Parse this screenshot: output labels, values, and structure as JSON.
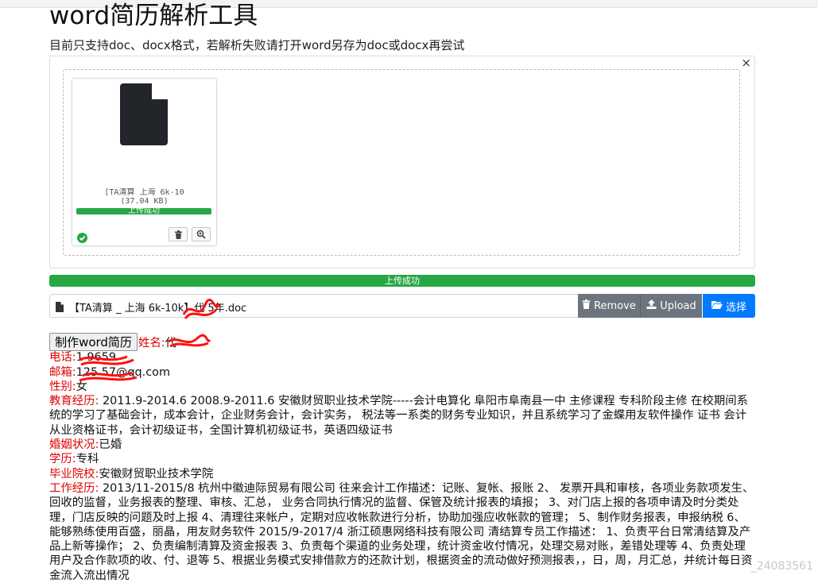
{
  "page": {
    "title": "word简历解析工具",
    "subtitle": "目前只支持doc、docx格式，若解析失败请打开word另存为doc或docx再尝试"
  },
  "dropzone": {
    "close_label": "×",
    "thumb": {
      "caption_line1": "[TA清算 上海 6k-10",
      "caption_line2": "(37.04 KB)",
      "status": "上传成功",
      "icons": [
        "file-icon",
        "check-circle-icon",
        "trash-icon",
        "zoom-icon"
      ]
    }
  },
  "progress": {
    "label": "上传成功",
    "percent": 100,
    "color": "#28a745"
  },
  "file_input": {
    "file_name": "【TA清算 _ 上海 6k-10k】代 5年.doc",
    "remove_label": "Remove",
    "upload_label": "Upload",
    "browse_label": "选择"
  },
  "make_button": {
    "label": "制作word简历"
  },
  "resume": {
    "name": {
      "key": "姓名:",
      "value": "代"
    },
    "phone": {
      "key": "电话:",
      "value": "1     9659"
    },
    "email": {
      "key": "邮箱:",
      "value": "125     57@qq.com"
    },
    "gender": {
      "key": "性别:",
      "value": "女"
    },
    "education": {
      "key": "教育经历:",
      "value": " 2011.9-2014.6 2008.9-2011.6 安徽财贸职业技术学院-----会计电算化 阜阳市阜南县一中 主修课程 专科阶段主修 在校期间系统的学习了基础会计，成本会计，企业财务会计，会计实务， 税法等一系类的财务专业知识，并且系统学习了金蝶用友软件操作 证书 会计从业资格证书，会计初级证书，全国计算机初级证书，英语四级证书"
    },
    "marital": {
      "key": "婚姻状况:",
      "value": "已婚"
    },
    "degree": {
      "key": "学历:",
      "value": "专科"
    },
    "school": {
      "key": "毕业院校:",
      "value": "安徽财贸职业技术学院"
    },
    "work": {
      "key": "工作经历:",
      "value": " 2013/11-2015/8 杭州中徽迪际贸易有限公司 往来会计工作描述：记账、复帐、报账 2、 发票开具和审核，各项业务款项发生、回收的监督，业务报表的整理、审核、汇总， 业务合同执行情况的监督、保管及统计报表的填报； 3、对门店上报的各项申请及时分类处理，门店反映的问题及时上报 4、清理往来帐户，定期对应收帐款进行分析，协助加强应收帐款的管理； 5、制作财务报表，申报纳税 6、能够熟练使用百盛，丽晶，用友财务软件 2015/9-2017/4 浙江硕惠网络科技有限公司 清结算专员工作描述： 1、负责平台日常清结算及产品上新等操作； 2、负责编制清算及资金报表 3、负责每个渠道的业务处理，统计资金收付情况，处理交易对账，差错处理等 4、负责处理用户及合作款项的收、付、退等 5、根据业务模式安排借款方的还款计划，根据资金的流动做好预测报表，，日，周，月汇总，并统计每日资金流入流出情况"
    }
  },
  "watermark": "_24083561"
}
